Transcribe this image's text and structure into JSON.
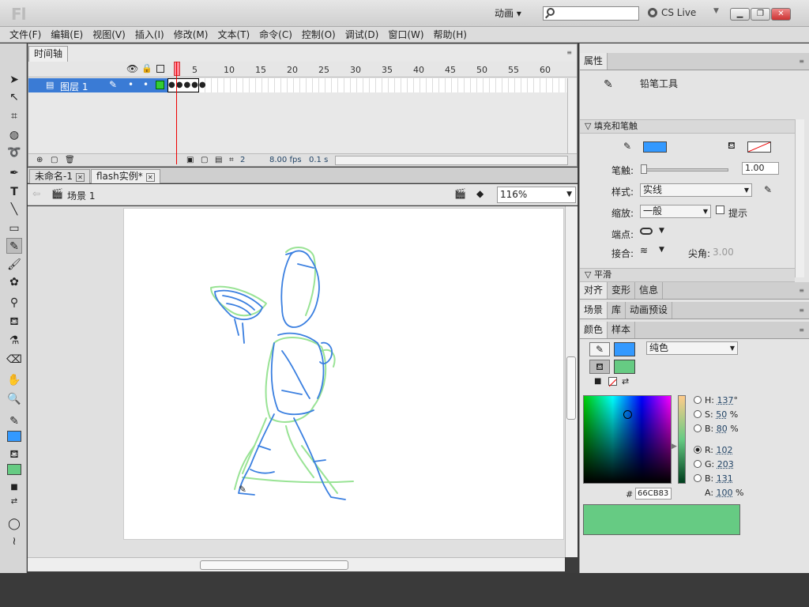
{
  "app": {
    "logo": "Fl",
    "workspace": "动画 ▾",
    "cslive": "CS Live"
  },
  "menu": [
    "文件(F)",
    "编辑(E)",
    "视图(V)",
    "插入(I)",
    "修改(M)",
    "文本(T)",
    "命令(C)",
    "控制(O)",
    "调试(D)",
    "窗口(W)",
    "帮助(H)"
  ],
  "timeline": {
    "tab": "时间轴",
    "frame_numbers": [
      "5",
      "10",
      "15",
      "20",
      "25",
      "30",
      "35",
      "40",
      "45",
      "50",
      "55",
      "60"
    ],
    "layer_name": "图层 1",
    "current_frame": "2",
    "fps": "8.00 fps",
    "time": "0.1 s"
  },
  "docs": [
    {
      "label": "未命名-1"
    },
    {
      "label": "flash实例*"
    }
  ],
  "scene": {
    "name": "场景 1",
    "zoom": "116%"
  },
  "properties": {
    "tab": "属性",
    "tool_name": "铅笔工具",
    "section_fill_stroke": "填充和笔触",
    "stroke_label": "笔触:",
    "stroke_value": "1.00",
    "style_label": "样式:",
    "style_value": "实线",
    "scale_label": "缩放:",
    "scale_value": "一般",
    "hint_label": "提示",
    "cap_label": "端点:",
    "join_label": "接合:",
    "miter_label": "尖角:",
    "miter_value": "3.00",
    "section_smooth": "平滑",
    "stroke_color": "#3399ff"
  },
  "tabs2": [
    "对齐",
    "变形",
    "信息"
  ],
  "tabs3": [
    "场景",
    "库",
    "动画预设"
  ],
  "color": {
    "tabs": [
      "颜色",
      "样本"
    ],
    "type": "纯色",
    "H_label": "H:",
    "H": "137",
    "H_unit": "°",
    "S_label": "S:",
    "S": "50",
    "S_unit": "%",
    "Bv_label": "B:",
    "Bv": "80",
    "Bv_unit": "%",
    "R_label": "R:",
    "R": "102",
    "G_label": "G:",
    "G": "203",
    "B_label": "B:",
    "B": "131",
    "A_label": "A:",
    "A": "100",
    "A_unit": "%",
    "hex_prefix": "#",
    "hex": "66CB83",
    "fill_color": "#66cb83"
  }
}
